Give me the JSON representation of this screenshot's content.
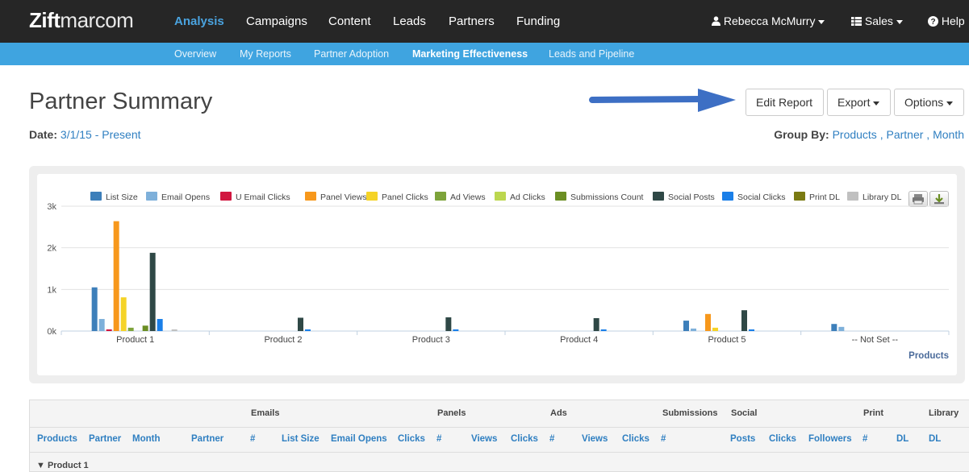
{
  "app": {
    "logo_bold": "Zift",
    "logo_light": "marcom"
  },
  "topnav": {
    "items": [
      "Analysis",
      "Campaigns",
      "Content",
      "Leads",
      "Partners",
      "Funding"
    ],
    "user": "Rebecca McMurry",
    "sales": "Sales",
    "help": "Help"
  },
  "subnav": {
    "items": [
      "Overview",
      "My Reports",
      "Partner Adoption",
      "Marketing Effectiveness",
      "Leads and Pipeline"
    ]
  },
  "page": {
    "title": "Partner Summary",
    "date_label": "Date:",
    "date_value": "3/1/15 - Present",
    "group_label": "Group By:",
    "group_values": [
      "Products",
      "Partner",
      "Month"
    ],
    "group_sep": ","
  },
  "buttons": {
    "edit": "Edit Report",
    "export": "Export",
    "options": "Options"
  },
  "chart_data": {
    "type": "bar",
    "categories": [
      "Product 1",
      "Product 2",
      "Product 3",
      "Product 4",
      "Product 5",
      "-- Not Set --"
    ],
    "xlabel": "Products",
    "ylabel": "",
    "ylim": [
      0,
      3000
    ],
    "yticks": [
      "0k",
      "1k",
      "2k",
      "3k"
    ],
    "grid": true,
    "legend_position": "top-right",
    "series": [
      {
        "name": "List Size",
        "color": "#3d7fba",
        "values": [
          1050,
          0,
          0,
          0,
          250,
          170
        ]
      },
      {
        "name": "Email Opens",
        "color": "#7eb0da",
        "values": [
          290,
          0,
          0,
          0,
          60,
          100
        ]
      },
      {
        "name": "U Email Clicks",
        "color": "#d1163f",
        "values": [
          40,
          0,
          0,
          0,
          0,
          0
        ]
      },
      {
        "name": "Panel Views",
        "color": "#f7981c",
        "values": [
          2640,
          0,
          0,
          0,
          410,
          0
        ]
      },
      {
        "name": "Panel Clicks",
        "color": "#f5d327",
        "values": [
          810,
          0,
          0,
          0,
          80,
          0
        ]
      },
      {
        "name": "Ad Views",
        "color": "#7da33a",
        "values": [
          80,
          0,
          0,
          0,
          0,
          0
        ]
      },
      {
        "name": "Ad Clicks",
        "color": "#bcd74f",
        "values": [
          0,
          0,
          0,
          0,
          0,
          0
        ]
      },
      {
        "name": "Submissions Count",
        "color": "#6b8e23",
        "values": [
          130,
          0,
          0,
          0,
          0,
          0
        ]
      },
      {
        "name": "Social Posts",
        "color": "#2f4846",
        "values": [
          1880,
          320,
          330,
          310,
          500,
          0
        ]
      },
      {
        "name": "Social Clicks",
        "color": "#1a7fe8",
        "values": [
          290,
          40,
          40,
          40,
          40,
          0
        ]
      },
      {
        "name": "Print DL",
        "color": "#7a7a12",
        "values": [
          0,
          0,
          0,
          0,
          0,
          0
        ]
      },
      {
        "name": "Library DL",
        "color": "#c0c0c0",
        "values": [
          40,
          0,
          0,
          0,
          0,
          0
        ]
      }
    ]
  },
  "table": {
    "group_headers": [
      "Emails",
      "Panels",
      "Ads",
      "Submissions",
      "Social",
      "Print",
      "Library"
    ],
    "columns": [
      "Products",
      "Partner",
      "Month",
      "Partner",
      "#",
      "List Size",
      "Email Opens",
      "Clicks",
      "#",
      "Views",
      "Clicks",
      "#",
      "Views",
      "Clicks",
      "#",
      "Posts",
      "Clicks",
      "Followers",
      "#",
      "DL",
      "DL"
    ],
    "first_group": "▼ Product 1"
  },
  "icons": {
    "user": "user-icon",
    "grid": "grid-icon",
    "help": "help-icon",
    "print": "print-icon",
    "download": "download-icon"
  }
}
